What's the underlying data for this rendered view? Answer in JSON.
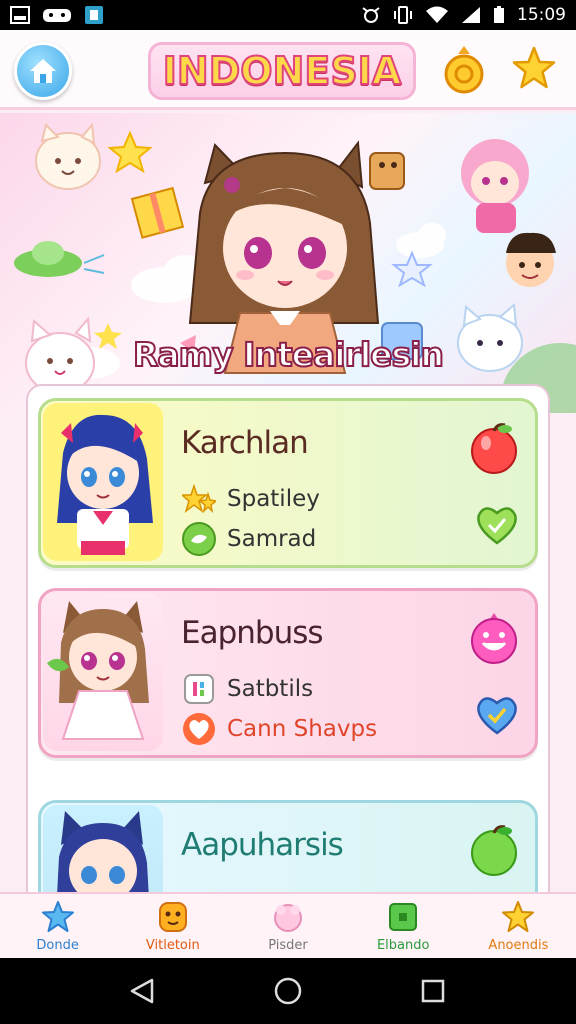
{
  "status_bar": {
    "time": "15:09",
    "left_icons": [
      "gallery-icon",
      "game-controller-icon",
      "app-notification-icon"
    ],
    "right_icons": [
      "alarm-icon",
      "vibrate-icon",
      "wifi-icon",
      "signal-icon",
      "battery-icon"
    ]
  },
  "header": {
    "title": "INDONESIA",
    "home_icon": "home-icon",
    "coin_icon": "coin-icon",
    "star_icon": "star-icon"
  },
  "banner": {
    "hero_name": "Ramy Inteairlesin"
  },
  "cards": [
    {
      "title": "Karchlan",
      "row_a": "Spatiley",
      "row_b": "Samrad",
      "top_icon": "apple-icon",
      "side_icon": "heart-icon",
      "accent": "#b6dd8c"
    },
    {
      "title": "Eapnbuss",
      "row_a": "Satbtils",
      "row_b": "Cann Shavps",
      "top_icon": "smiley-icon",
      "side_icon": "heart-icon",
      "accent": "#f1a3c4"
    },
    {
      "title": "Aapuharsis",
      "top_icon": "apple-icon",
      "accent": "#9ed7e0"
    }
  ],
  "bottom_nav": [
    {
      "label": "Donde",
      "icon": "star-icon",
      "color": "#2a7fd0"
    },
    {
      "label": "Vitletoin",
      "icon": "face-icon",
      "color": "#e05a10"
    },
    {
      "label": "Pisder",
      "icon": "puff-icon",
      "color": "#777777"
    },
    {
      "label": "Elbando",
      "icon": "square-icon",
      "color": "#2a9a3a"
    },
    {
      "label": "Anoendis",
      "icon": "star-icon",
      "color": "#e07a10"
    }
  ],
  "system_nav": {
    "back_icon": "back-icon",
    "home_icon": "circle-home-icon",
    "recents_icon": "recents-icon"
  }
}
